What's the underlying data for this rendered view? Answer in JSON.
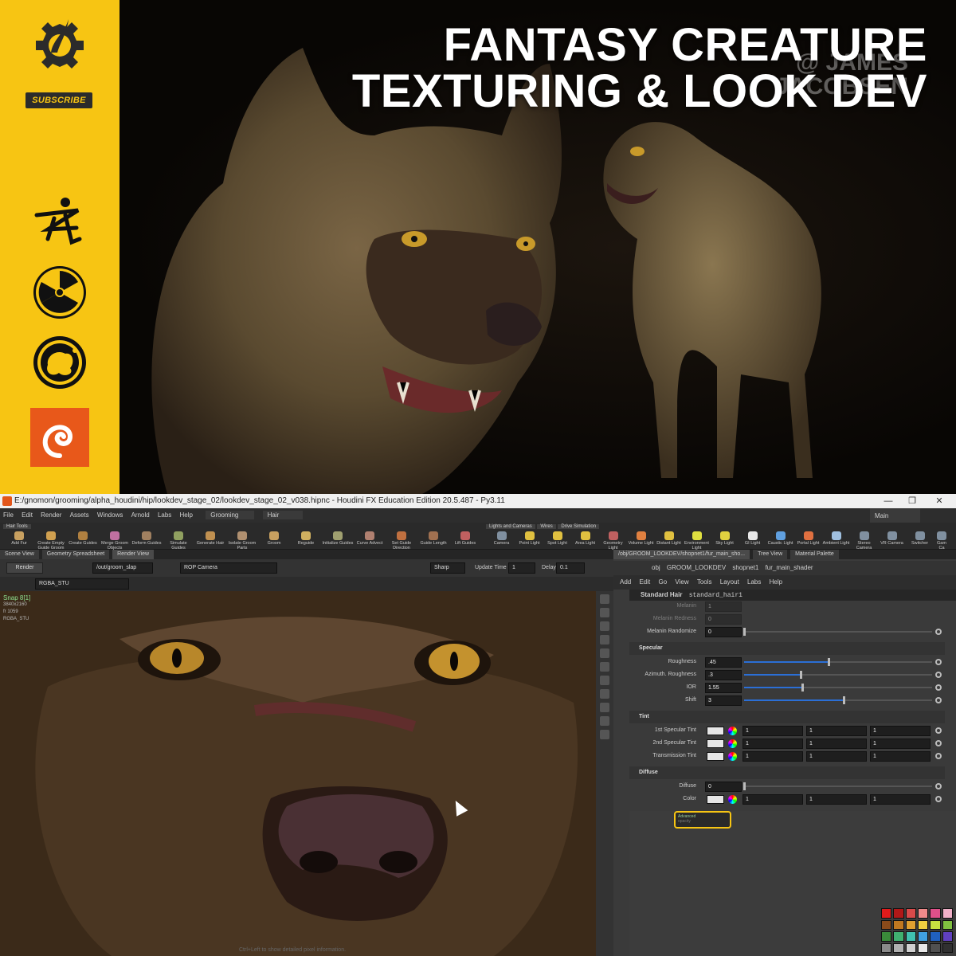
{
  "banner": {
    "title_line1": "FANTASY CREATURE",
    "title_line2": "TEXTURING & LOOK DEV",
    "watermark_line1": "@ JAMES",
    "watermark_line2": "JACOBSEN",
    "subscribe_label": "SUBSCRIBE",
    "brand_color": "#f7c513",
    "sidebar_icons": [
      "gnomon-logo-icon",
      "zbrush-icon",
      "substance-icon",
      "mari-icon",
      "houdini-icon"
    ]
  },
  "app": {
    "window_title": "E:/gnomon/grooming/alpha_houdini/hip/lookdev_stage_02/lookdev_stage_02_v038.hipnc - Houdini FX Education Edition 20.5.487 - Py3.11",
    "menu": [
      "File",
      "Edit",
      "Render",
      "Assets",
      "Windows",
      "Arnold",
      "Labs",
      "Help"
    ],
    "desktop": "Grooming",
    "context": "Hair",
    "main_label": "Main",
    "shelf_tab_left": "Hair Tools",
    "shelf_tabs_right": [
      "Lights and Cameras",
      "Wires",
      "Drive Simulation"
    ],
    "left_tools": [
      "Add Fur",
      "Create Empty Guide Groom",
      "Create Guides",
      "Merge Groom Objects",
      "Deform Guides",
      "Simulate Guides",
      "Generate Hair",
      "Isolate Groom Parts",
      "Groom",
      "Reguide",
      "Initialize Guides",
      "Curve Advect",
      "Set Guide Direction",
      "Guide Length",
      "Lift Guides"
    ],
    "right_tools": [
      "Camera",
      "Point Light",
      "Spot Light",
      "Area Light",
      "Geometry Light",
      "Volume Light",
      "Distant Light",
      "Environment Light",
      "Sky Light",
      "GI Light",
      "Caustic Light",
      "Portal Light",
      "Ambient Light",
      "Stereo Camera",
      "VR Camera",
      "Switcher",
      "Gam Ca"
    ]
  },
  "left_pane": {
    "tabs": [
      "Scene View",
      "Geometry Spreadsheet",
      "Render View"
    ],
    "render_button": "Render",
    "rop_path": "/out/groom_slap",
    "camera": "ROP Camera",
    "sharp": "Sharp",
    "update_time_label": "Update Time",
    "update_time_value": "1",
    "delay_label": "Delay",
    "delay_value": "0.1",
    "aov": "RGBA_STU",
    "snap_title": "Snap 8[1]",
    "snap_info": [
      "3840x2160",
      "fr 1059",
      "RGBA_STU"
    ],
    "hint": "Ctrl+Left to show detailed pixel information."
  },
  "right_pane": {
    "tabs": [
      "/obj/GROOM_LOOKDEV/shopnet1/fur_main_sho...",
      "Tree View",
      "Material Palette"
    ],
    "path": [
      "obj",
      "GROOM_LOOKDEV",
      "shopnet1",
      "fur_main_shader"
    ],
    "menu": [
      "Add",
      "Edit",
      "Go",
      "View",
      "Tools",
      "Layout",
      "Labs",
      "Help"
    ],
    "node_type": "Standard Hair",
    "node_name": "standard_hair1",
    "params_top": [
      {
        "label": "Melanin",
        "value": "1"
      },
      {
        "label": "Melanin Redness",
        "value": "0"
      },
      {
        "label": "Melanin Randomize",
        "value": "0",
        "fill": 0
      }
    ],
    "specular_title": "Specular",
    "specular": [
      {
        "label": "Roughness",
        "value": ".45",
        "fill": 0.45
      },
      {
        "label": "Azimuth. Roughness",
        "value": ".3",
        "fill": 0.3
      },
      {
        "label": "IOR",
        "value": "1.55",
        "fill": 0.31
      },
      {
        "label": "Shift",
        "value": "3",
        "fill": 0.53
      }
    ],
    "tint_title": "Tint",
    "tint": [
      {
        "label": "1st Specular Tint",
        "r": "1",
        "g": "1",
        "b": "1"
      },
      {
        "label": "2nd Specular Tint",
        "r": "1",
        "g": "1",
        "b": "1"
      },
      {
        "label": "Transmission Tint",
        "r": "1",
        "g": "1",
        "b": "1"
      }
    ],
    "diffuse_title": "Diffuse",
    "diffuse": {
      "label": "Diffuse",
      "value": "0",
      "fill": 0
    },
    "color": {
      "label": "Color",
      "r": "1",
      "g": "1",
      "b": "1"
    },
    "node_title": "Advanced",
    "node_sub": "opacity",
    "palette": [
      "#e01b1b",
      "#b01818",
      "#d94a4a",
      "#f08a8a",
      "#e0508a",
      "#f0b0c8",
      "#8a4a1a",
      "#c07820",
      "#e0a030",
      "#f0d040",
      "#c8e040",
      "#80c040",
      "#3a8a3a",
      "#40b070",
      "#40c0b0",
      "#40a0e0",
      "#2060c0",
      "#6040c0",
      "#8a8a8a",
      "#b0b0b0",
      "#d0d0d0",
      "#e8e8e8",
      "#505050",
      "#303030"
    ]
  }
}
